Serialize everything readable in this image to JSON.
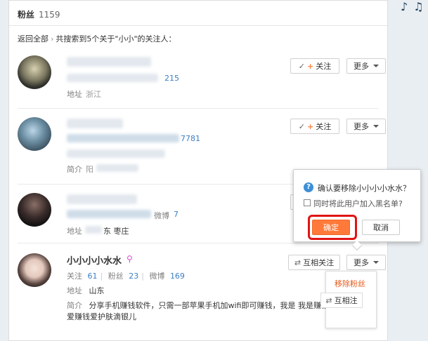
{
  "header": {
    "title": "粉丝",
    "count": "1159"
  },
  "breadcrumb": {
    "back": "返回全部",
    "separator": "›",
    "result": "共搜索到5个关于\"小小\"的关注人："
  },
  "rows": [
    {
      "weibo_count": "215",
      "location_label": "地址",
      "location_value": "浙江 ",
      "follow": "关注",
      "more": "更多"
    },
    {
      "weibo_count": "7781",
      "intro_label": "简介",
      "intro_value": "阳",
      "follow": "关注",
      "more": "更多"
    },
    {
      "weibo_label": "微博",
      "weibo_count": "7",
      "location_label": "地址",
      "location_value": "东 枣庄"
    },
    {
      "name": "小小小小水水",
      "follow_label": "关注",
      "follow_count": "61",
      "fans_label": "粉丝",
      "fans_count": "23",
      "weibo_label": "微博",
      "weibo_count": "169",
      "location_label": "地址",
      "location_value": "山东",
      "intro_label": "简介",
      "intro_value": "分享手机赚钱软件，只需一部苹果手机加wifi即可赚钱，我是  我是赚钱",
      "intro_value2": "爱赚钱爱护肤滴银儿",
      "mutual": "互相关注",
      "more": "更多"
    }
  ],
  "dialog": {
    "question": "确认要移除小小小小水水？",
    "checkbox_label": "同时将此用户加入黑名单?",
    "confirm": "确定",
    "cancel": "取消"
  },
  "dropdown": {
    "remove": "移除粉丝",
    "mutual": "互相注"
  },
  "colors": {
    "accent": "#ff7a3a",
    "link": "#3b7fc4",
    "highlight": "#e01414"
  }
}
